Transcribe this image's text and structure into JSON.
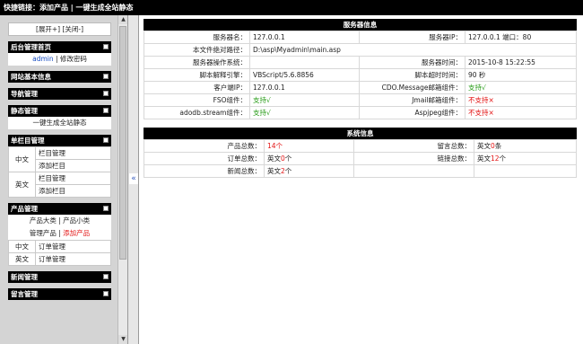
{
  "topbar": {
    "prefix": "快捷链接：",
    "link1": "添加产品",
    "sep": " | ",
    "link2": "一键生成全站静态"
  },
  "sidebar": {
    "expand_collapse": "[展开+] [关闭-]",
    "admin": {
      "title": "后台管理首页",
      "user": "admin",
      "sep": " | ",
      "change_pwd": "修改密码"
    },
    "site_info": {
      "title": "网站基本信息"
    },
    "nav": {
      "title": "导航管理"
    },
    "static": {
      "title": "静态管理",
      "item": "一键生成全站静态"
    },
    "single": {
      "title": "单栏目管理",
      "rows": [
        {
          "lang": "中文",
          "items": [
            "栏目管理",
            "添加栏目"
          ]
        },
        {
          "lang": "英文",
          "items": [
            "栏目管理",
            "添加栏目"
          ]
        }
      ]
    },
    "product": {
      "title": "产品管理",
      "line1_a": "产品大类",
      "line1_sep": " | ",
      "line1_b": "产品小类",
      "line2_a": "管理产品",
      "line2_sep": " | ",
      "line2_b": "添加产品",
      "orders": [
        {
          "lang": "中文",
          "item": "订单管理"
        },
        {
          "lang": "英文",
          "item": "订单管理"
        }
      ]
    },
    "news": {
      "title": "新闻管理"
    },
    "messages": {
      "title": "留言管理"
    }
  },
  "divider": {
    "toggle": "«"
  },
  "server": {
    "title": "服务器信息",
    "rows": [
      {
        "k1": "服务器名：",
        "v1": "127.0.0.1",
        "k2": "服务器IP：",
        "v2": "127.0.0.1 端口：80"
      },
      {
        "k1": "本文件绝对路径：",
        "v1": "D:\\asp\\Myadmin\\main.asp",
        "k2": "",
        "v2": ""
      },
      {
        "k1": "服务器操作系统：",
        "v1": "",
        "k2": "服务器时间：",
        "v2": "2015-10-8 15:22:55"
      },
      {
        "k1": "脚本解释引擎：",
        "v1": "VBScript/5.6.8856",
        "k2": "脚本超时时间：",
        "v2": "90 秒"
      },
      {
        "k1": "客户端IP：",
        "v1": "127.0.0.1",
        "k2": "CDO.Message邮箱组件：",
        "v2": "支持√"
      },
      {
        "k1": "FSO组件：",
        "v1": "支持√",
        "k2": "Jmail邮箱组件：",
        "v2": "不支持×"
      },
      {
        "k1": "adodb.stream组件：",
        "v1": "支持√",
        "k2": "Aspjpeg组件：",
        "v2": "不支持×"
      }
    ]
  },
  "stats": {
    "title": "系统信息",
    "rows": [
      {
        "k1": "产品总数：",
        "v1_num": "14个",
        "k2": "留言总数：",
        "v2_pre": "英文",
        "v2_num": "0",
        "v2_suf": "条"
      },
      {
        "k1": "订单总数：",
        "v1_pre": "英文",
        "v1_num": "0",
        "v1_suf": "个",
        "k2": "链接总数：",
        "v2_pre": "英文",
        "v2_num": "12",
        "v2_suf": "个"
      },
      {
        "k1": "新闻总数：",
        "v1_pre": "英文",
        "v1_num": "2",
        "v1_suf": "个"
      }
    ]
  },
  "colors": {
    "accent_link": "#1a4fc4",
    "red": "#e31414",
    "green": "#2a9d1a"
  }
}
